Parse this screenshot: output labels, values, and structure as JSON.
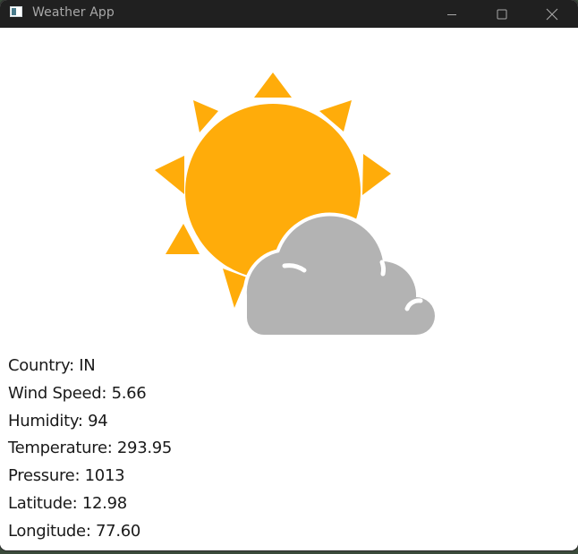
{
  "window": {
    "title": "Weather App",
    "controls": {
      "minimize_icon": "minimize-icon",
      "maximize_icon": "maximize-icon",
      "close_icon": "close-icon"
    }
  },
  "weather": {
    "icon": "partly-sunny-icon",
    "colors": {
      "sun": "#FFAC0A",
      "cloud": "#B3B3B3",
      "background": "#FFFFFF"
    },
    "details": [
      {
        "label": "Country",
        "value": "IN",
        "text": "Country: IN"
      },
      {
        "label": "Wind Speed",
        "value": "5.66",
        "text": "Wind Speed: 5.66"
      },
      {
        "label": "Humidity",
        "value": "94",
        "text": "Humidity: 94"
      },
      {
        "label": "Temperature",
        "value": "293.95",
        "text": "Temperature: 293.95"
      },
      {
        "label": "Pressure",
        "value": "1013",
        "text": "Pressure: 1013"
      },
      {
        "label": "Latitude",
        "value": "12.98",
        "text": "Latitude: 12.98"
      },
      {
        "label": "Longitude",
        "value": "77.60",
        "text": "Longitude: 77.60"
      }
    ]
  }
}
